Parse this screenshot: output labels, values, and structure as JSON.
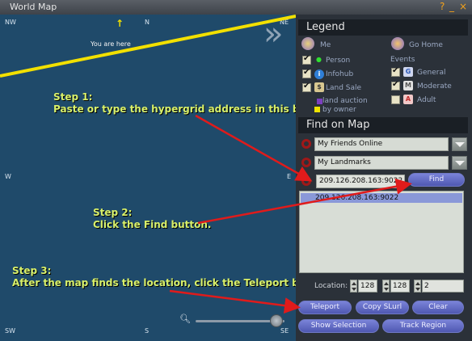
{
  "window": {
    "title": "World Map",
    "help_glyph": "?",
    "min_glyph": "_",
    "close_glyph": "×"
  },
  "map": {
    "compass": {
      "nw": "NW",
      "n": "N",
      "ne": "NE",
      "w": "W",
      "e": "E",
      "sw": "SW",
      "s": "S",
      "se": "SE"
    },
    "you_are_here": "You are here",
    "expand_glyph": "»",
    "zoom_level": 0.9
  },
  "annotations": {
    "step1_title": "Step 1:",
    "step1_text": "Paste or type the hypergrid address in this box.",
    "step2_title": "Step 2:",
    "step2_text": "Click the Find button.",
    "step3_title": "Step 3:",
    "step3_text": "After the map finds the location, click the Teleport button."
  },
  "legend": {
    "title": "Legend",
    "me": "Me",
    "go_home": "Go Home",
    "person": "Person",
    "infohub": "Infohub",
    "land_sale": "Land Sale",
    "land_auction": "land auction",
    "by_owner": "by owner",
    "events": "Events",
    "general": "General",
    "moderate": "Moderate",
    "adult": "Adult",
    "g": "G",
    "m": "M",
    "a": "A"
  },
  "find": {
    "title": "Find on Map",
    "friends": "My Friends Online",
    "landmarks": "My Landmarks",
    "address": "209.126.208.163:9022",
    "find_label": "Find",
    "results": [
      "209.126.208.163:9022"
    ],
    "location_label": "Location:",
    "x": "128",
    "y": "128",
    "z": "2"
  },
  "buttons": {
    "teleport": "Teleport",
    "copy_slurl": "Copy SLurl",
    "clear": "Clear",
    "show_selection": "Show Selection",
    "track_region": "Track Region"
  },
  "colors": {
    "accent": "#5a63c2",
    "step_text": "#d8f06a",
    "arrow": "#e01b1b",
    "map": "#1f4a6a"
  }
}
